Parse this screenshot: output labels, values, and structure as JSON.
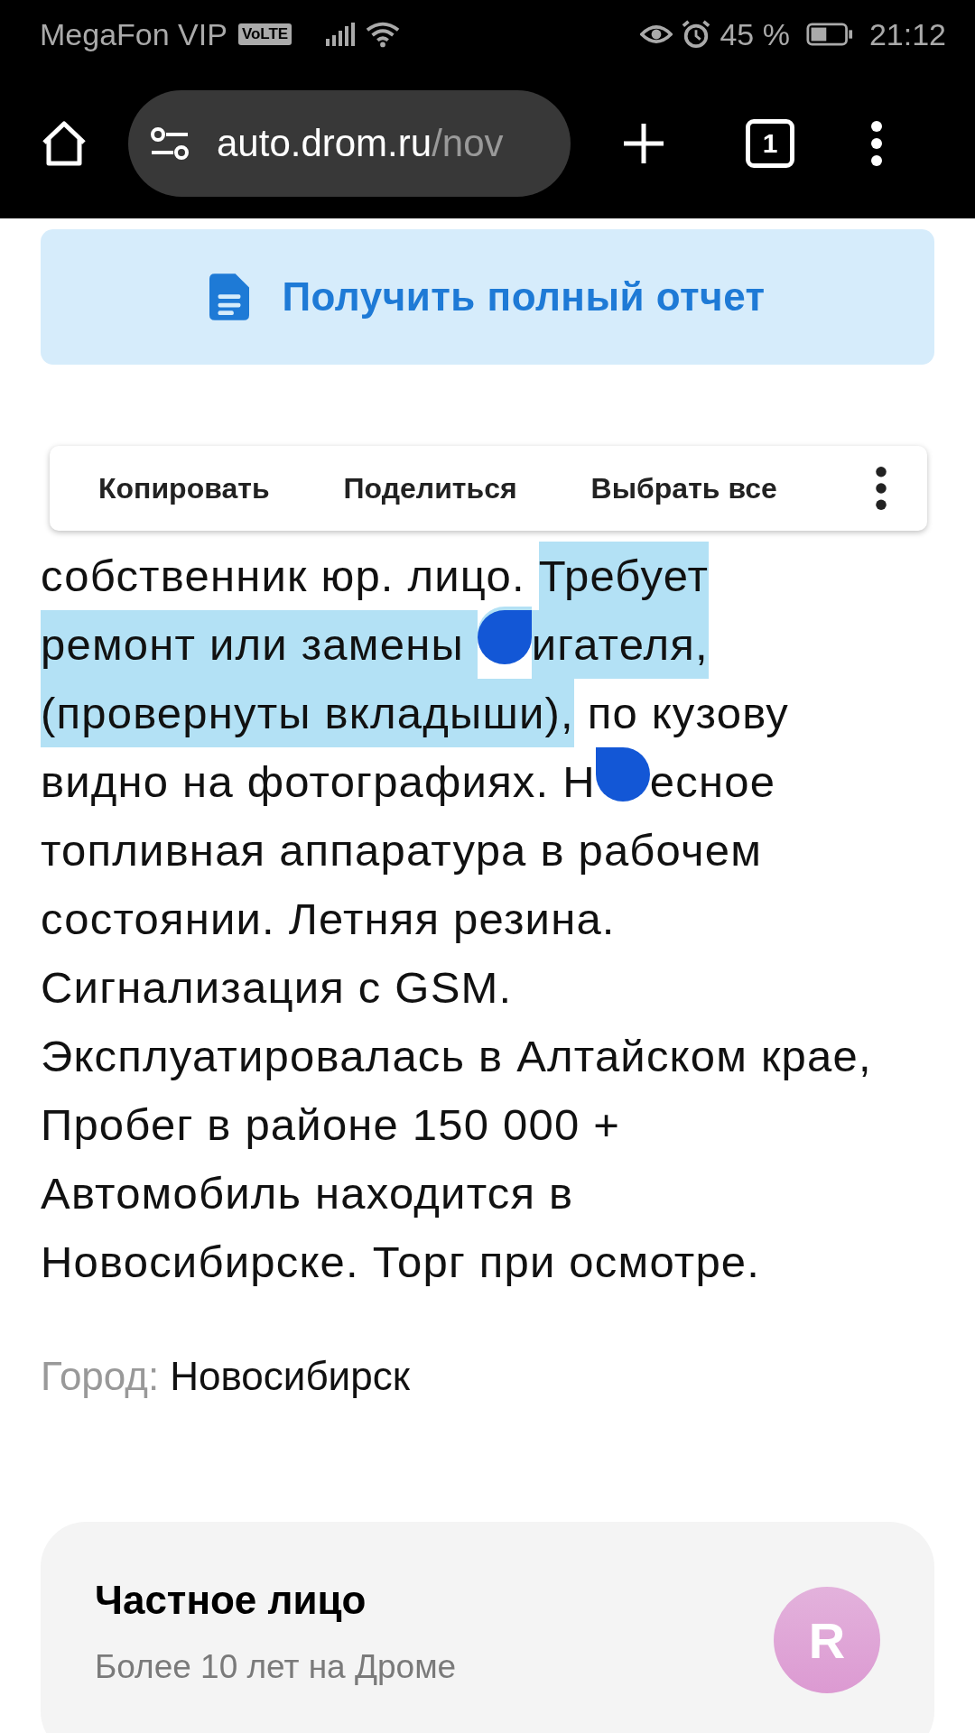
{
  "status_bar": {
    "carrier": "MegaFon VIP",
    "network_badge": "VoLTE",
    "battery_percent": "45 %",
    "time": "21:12"
  },
  "browser": {
    "url_host": "auto.drom.ru",
    "url_path": "/nov",
    "tab_count": "1"
  },
  "report_button": {
    "label": "Получить полный отчет"
  },
  "selection_menu": {
    "actions": [
      "Копировать",
      "Поделиться",
      "Выбрать все"
    ]
  },
  "description_lines": [
    {
      "segments": [
        {
          "text": "собственник юр. лицо. ",
          "selected": false
        },
        {
          "text": "Требует",
          "selected": true
        }
      ]
    },
    {
      "segments": [
        {
          "kind": "text",
          "text": "ремонт или замены ",
          "selected": true
        },
        {
          "kind": "start_handle"
        },
        {
          "kind": "text",
          "text": "игателя,",
          "selected": true
        }
      ]
    },
    {
      "segments": [
        {
          "text": "(провернуты вкладыши),",
          "selected": true
        },
        {
          "text": " по кузову",
          "selected": false
        }
      ]
    },
    {
      "segments": [
        {
          "kind": "text",
          "text": "видно на фотографиях. Н",
          "selected": false
        },
        {
          "kind": "end_handle"
        },
        {
          "kind": "text",
          "text": "есное",
          "selected": false
        }
      ]
    },
    {
      "segments": [
        {
          "text": "топливная аппаратура в рабочем",
          "selected": false
        }
      ]
    },
    {
      "segments": [
        {
          "text": "состоянии. Летняя резина.",
          "selected": false
        }
      ]
    },
    {
      "segments": [
        {
          "text": "Сигнализация с GSM.",
          "selected": false
        }
      ]
    },
    {
      "segments": [
        {
          "text": "Эксплуатировалась в Алтайском крае,",
          "selected": false
        }
      ]
    },
    {
      "segments": [
        {
          "text": "Пробег в районе 150 000 +",
          "selected": false
        }
      ]
    },
    {
      "segments": [
        {
          "text": "Автомобиль находится в",
          "selected": false
        }
      ]
    },
    {
      "segments": [
        {
          "text": "Новосибирске. Торг при осмотре.",
          "selected": false
        }
      ]
    }
  ],
  "city": {
    "label": "Город:",
    "value": "Новосибирск"
  },
  "seller_card": {
    "title": "Частное лицо",
    "subtitle": "Более 10 лет на Дроме",
    "avatar_letter": "R"
  }
}
